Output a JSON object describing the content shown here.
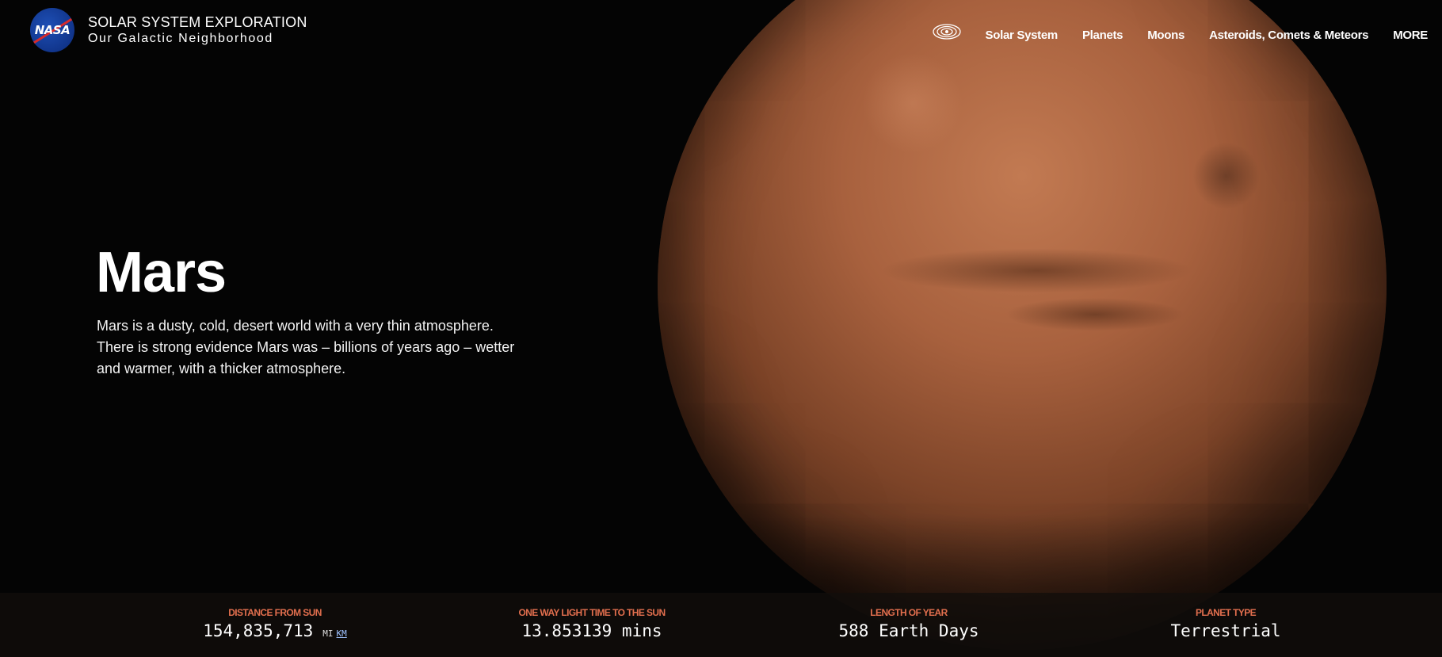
{
  "header": {
    "logo_text": "NASA",
    "site_title": "SOLAR SYSTEM EXPLORATION",
    "site_subtitle": "Our Galactic Neighborhood",
    "nav_icon": "solar-system-orbit-icon",
    "nav_items": [
      {
        "label": "Solar System"
      },
      {
        "label": "Planets"
      },
      {
        "label": "Moons"
      },
      {
        "label": "Asteroids, Comets & Meteors"
      },
      {
        "label": "MORE"
      }
    ]
  },
  "hero": {
    "title": "Mars",
    "description": "Mars is a dusty, cold, desert world with a very thin atmosphere. There is strong evidence Mars was – billions of years ago – wetter and warmer, with a thicker atmosphere."
  },
  "facts": [
    {
      "label": "DISTANCE FROM SUN",
      "value": "154,835,713",
      "unit": "MI",
      "unit_alt": "KM"
    },
    {
      "label": "ONE WAY LIGHT TIME TO THE SUN",
      "value": "13.853139 mins"
    },
    {
      "label": "LENGTH OF YEAR",
      "value": "588 Earth Days"
    },
    {
      "label": "PLANET TYPE",
      "value": "Terrestrial"
    }
  ],
  "colors": {
    "background": "#040404",
    "fact_label": "#e26f4e",
    "planet": "#a8613e"
  }
}
